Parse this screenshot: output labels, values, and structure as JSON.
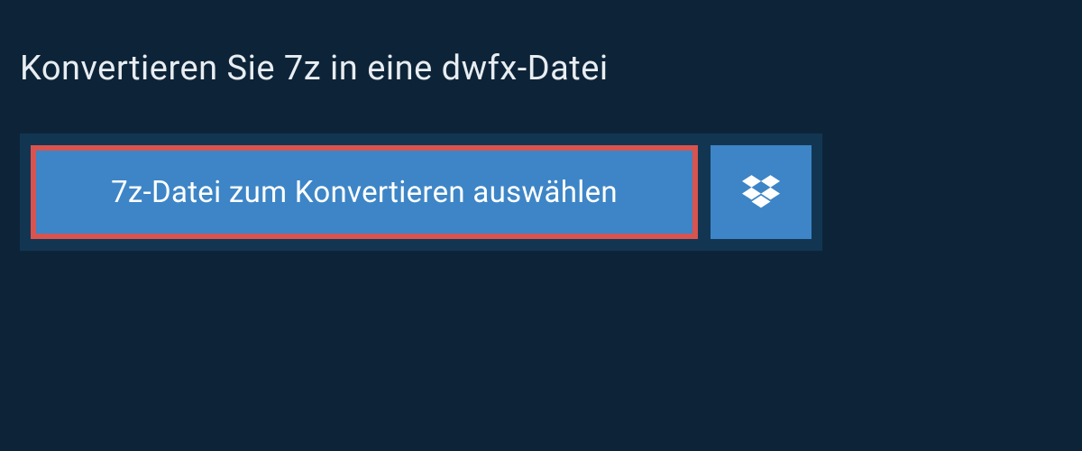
{
  "heading": {
    "title": "Konvertieren Sie 7z in eine dwfx-Datei"
  },
  "panel": {
    "select_file_label": "7z-Datei zum Konvertieren auswählen",
    "dropbox_icon_name": "dropbox"
  },
  "colors": {
    "background": "#0d2438",
    "panel": "#123652",
    "button": "#3d85c6",
    "highlight_border": "#d9534f",
    "text_light": "#ffffff"
  }
}
